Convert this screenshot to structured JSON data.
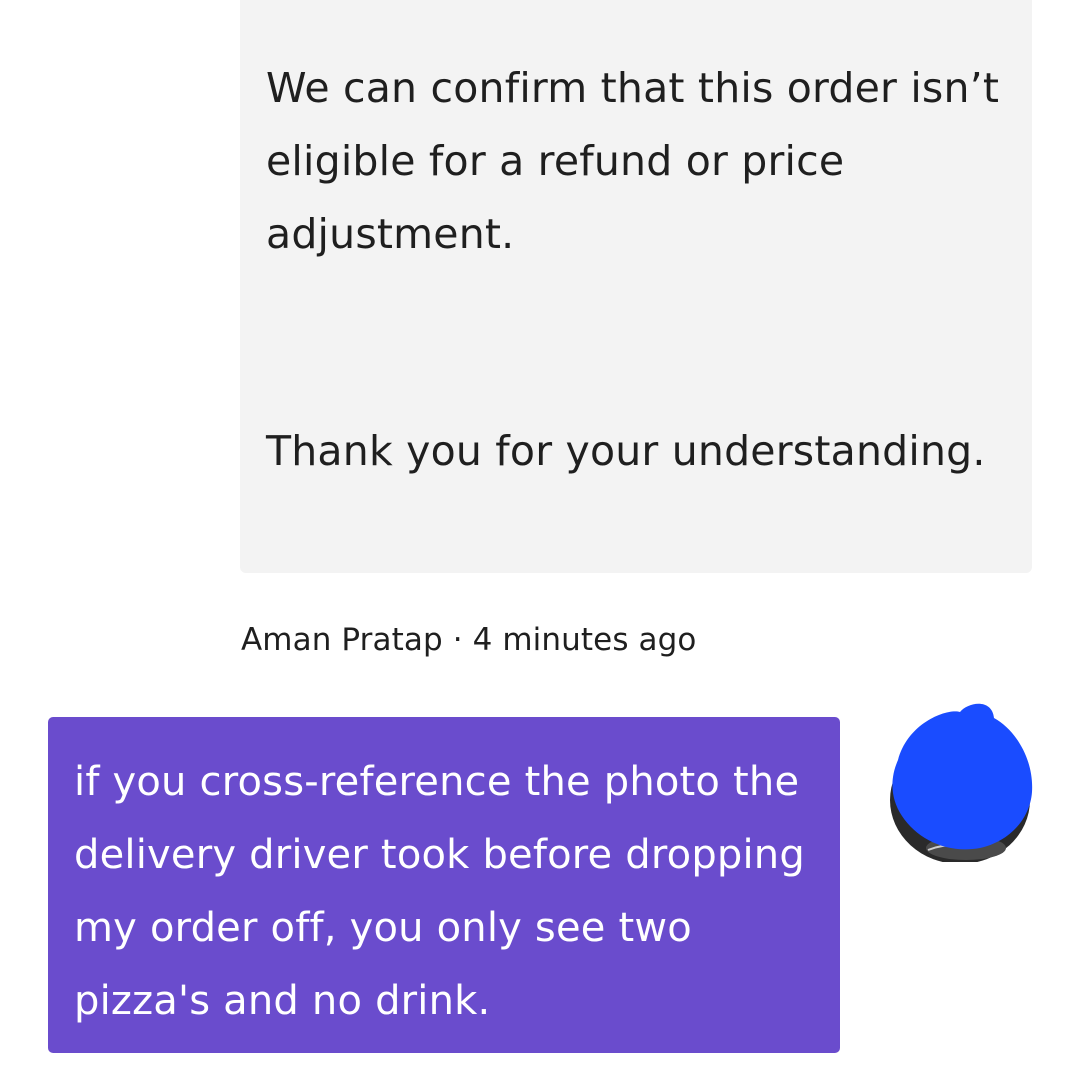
{
  "agent_message": {
    "paragraph_1": "We can confirm that this order isn’t eligible for a refund or price adjustment.",
    "paragraph_2": "Thank you for your understanding."
  },
  "user_message_meta": {
    "sender_name": "Aman Pratap",
    "separator": " · ",
    "timestamp": "4 minutes ago"
  },
  "user_message": {
    "text": "if you cross-reference the photo the delivery driver took before dropping my order off, you only see two pizza's and no drink."
  },
  "colors": {
    "agent_bubble": "#f3f3f3",
    "user_bubble": "#6a4ccd",
    "avatar_redaction": "#1a4cff"
  },
  "icons": {
    "avatar": "user-avatar-redacted"
  }
}
